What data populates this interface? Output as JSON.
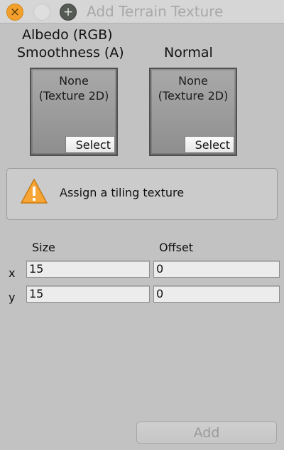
{
  "window": {
    "title": "Add Terrain Texture",
    "close_glyph": "×",
    "zoom_glyph": "+"
  },
  "textures": {
    "albedo": {
      "label_line1": "Albedo (RGB)",
      "label_line2": "Smoothness (A)",
      "slot_line1": "None",
      "slot_line2": "(Texture 2D)",
      "select_label": "Select"
    },
    "normal": {
      "label": "Normal",
      "slot_line1": "None",
      "slot_line2": "(Texture 2D)",
      "select_label": "Select"
    }
  },
  "helpbox": {
    "icon": "warning-icon",
    "message": "Assign a tiling texture",
    "icon_color": "#f7a535"
  },
  "tiling": {
    "size_header": "Size",
    "offset_header": "Offset",
    "x_label": "x",
    "y_label": "y",
    "size_x": "15",
    "size_y": "15",
    "offset_x": "0",
    "offset_y": "0"
  },
  "footer": {
    "add_label": "Add"
  }
}
